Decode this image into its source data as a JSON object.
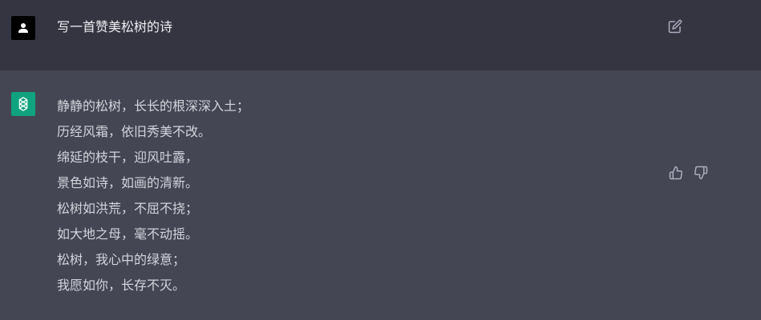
{
  "conversation": {
    "user_message": {
      "avatar_icon": "user-icon",
      "text": "写一首赞美松树的诗",
      "edit_icon": "edit-icon"
    },
    "assistant_message": {
      "avatar_icon": "openai-logo-icon",
      "lines": [
        "静静的松树，长长的根深深入土；",
        "历经风霜，依旧秀美不改。",
        "绵延的枝干，迎风吐露，",
        "景色如诗，如画的清新。",
        "松树如洪荒，不屈不挠；",
        "如大地之母，毫不动摇。",
        "松树，我心中的绿意；",
        "我愿如你，长存不灭。"
      ],
      "like_icon": "thumbs-up-icon",
      "dislike_icon": "thumbs-down-icon"
    }
  },
  "colors": {
    "user_row_bg": "#343541",
    "assistant_row_bg": "#444654",
    "bot_avatar_bg": "#10a37f",
    "text": "#d1d5db"
  }
}
